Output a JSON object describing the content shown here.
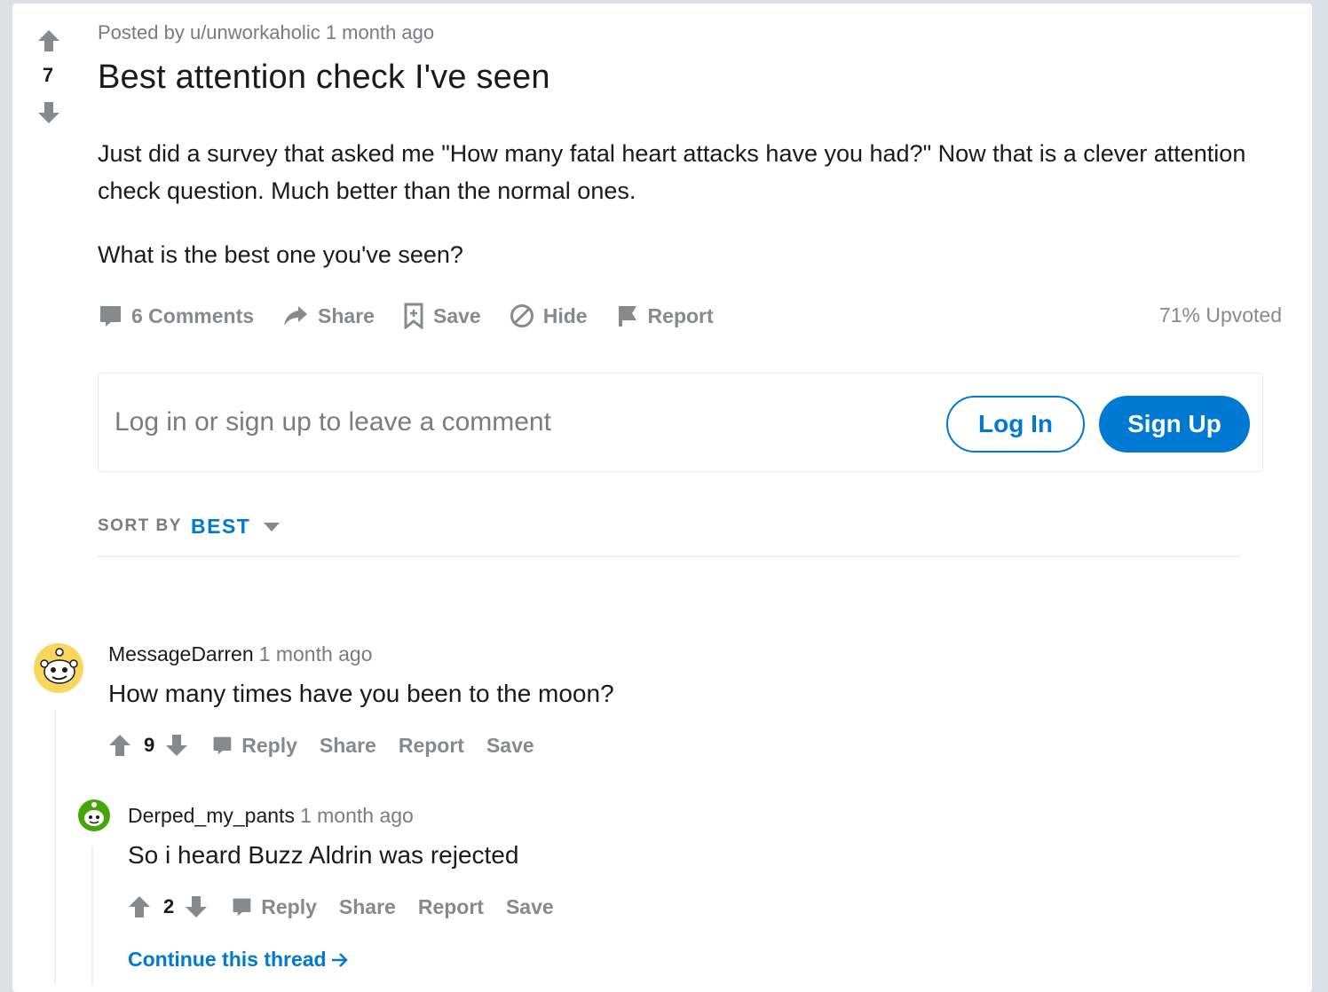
{
  "post": {
    "score": "7",
    "posted_by": "Posted by u/unworkaholic",
    "time": "1 month ago",
    "title": "Best attention check I've seen",
    "paragraphs": [
      "Just did a survey that asked me \"How many fatal heart attacks have you had?\" Now that is a clever attention check question. Much better than the normal ones.",
      "What is the best one you've seen?"
    ],
    "actions": {
      "comments": "6 Comments",
      "share": "Share",
      "save": "Save",
      "hide": "Hide",
      "report": "Report"
    },
    "upvoted": "71% Upvoted"
  },
  "login_prompt": {
    "text": "Log in or sign up to leave a comment",
    "login_label": "Log In",
    "signup_label": "Sign Up"
  },
  "sort": {
    "label": "SORT BY",
    "value": "BEST"
  },
  "comments": [
    {
      "author": "MessageDarren",
      "time": "1 month ago",
      "text": "How many times have you been to the moon?",
      "score": "9",
      "actions": {
        "reply": "Reply",
        "share": "Share",
        "report": "Report",
        "save": "Save"
      },
      "avatar_color": "#f9d65c"
    },
    {
      "author": "Derped_my_pants",
      "time": "1 month ago",
      "text": "So i heard Buzz Aldrin was rejected",
      "score": "2",
      "actions": {
        "reply": "Reply",
        "share": "Share",
        "report": "Report",
        "save": "Save"
      },
      "avatar_color": "#46a508"
    }
  ],
  "continue_thread": "Continue this thread",
  "colors": {
    "accent": "#0079d3",
    "muted": "#878a8c",
    "text": "#1a1a1b",
    "background": "#dae0e6"
  }
}
